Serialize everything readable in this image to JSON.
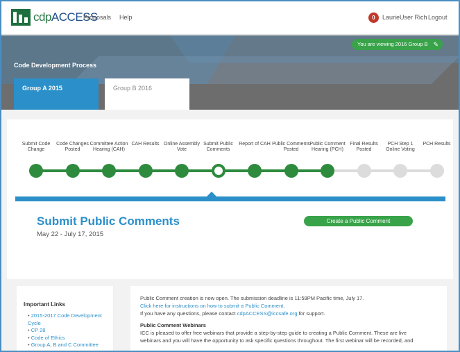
{
  "nav": {
    "logo_cdp": "cdp",
    "logo_access": "ACCESS",
    "proposals": "Proposals",
    "help": "Help",
    "notifications": "0",
    "user": "LaurieUser Rich",
    "logout": "Logout"
  },
  "banner": {
    "viewing": "You are viewing 2016 Group B",
    "title": "Code Development Process",
    "tabs": [
      "Group A 2015",
      "Group B 2016"
    ]
  },
  "steps": [
    {
      "label": "Submit Code Change",
      "status": "done"
    },
    {
      "label": "Code Changes Posted",
      "status": "done"
    },
    {
      "label": "Committee Action Hearing (CAH)",
      "status": "done"
    },
    {
      "label": "CAH Results",
      "status": "done"
    },
    {
      "label": "Online Assembly Vote",
      "status": "done"
    },
    {
      "label": "Submit Public Comments",
      "status": "current"
    },
    {
      "label": "Report of CAH",
      "status": "done"
    },
    {
      "label": "Public Comments Posted",
      "status": "done"
    },
    {
      "label": "Public Comment Hearing (PCH)",
      "status": "done"
    },
    {
      "label": "Final Results Posted",
      "status": "todo"
    },
    {
      "label": "PCH Step 1 Online Voting",
      "status": "todo"
    },
    {
      "label": "PCH Results",
      "status": "todo"
    }
  ],
  "stage": {
    "title": "Submit Public Comments",
    "dates": "May 22 - July 17, 2015",
    "create_button": "Create a Public Comment"
  },
  "sidebar": {
    "heading": "Important Links",
    "links": [
      "2015-2017 Code Development Cycle",
      "CP 28",
      "Code of Ethics",
      "Group A, B and C Committee"
    ]
  },
  "content": {
    "line1": "Public Comment creation is now open.  The submission deadline is 11:59PM Pacific time, July 17.",
    "line2": "Click here for instructions on how to submit a Public Comment.",
    "line3_pre": "If you have any questions, please contact ",
    "line3_email": "cdpACCESS@iccsafe.org",
    "line3_post": " for support.",
    "webinar_heading": "Public Comment Webinars",
    "webinar_line1": "ICC is pleased to offer free webinars that provide a step-by-step guide to creating a Public Comment.  These are live",
    "webinar_line2": "webinars and you will have the opportunity to ask specific questions throughout.  The first webinar will be recorded, and"
  },
  "colors": {
    "accent_blue": "#2b8fc9",
    "accent_green": "#2e8b3e",
    "banner_gray": "#6d6d6d"
  }
}
